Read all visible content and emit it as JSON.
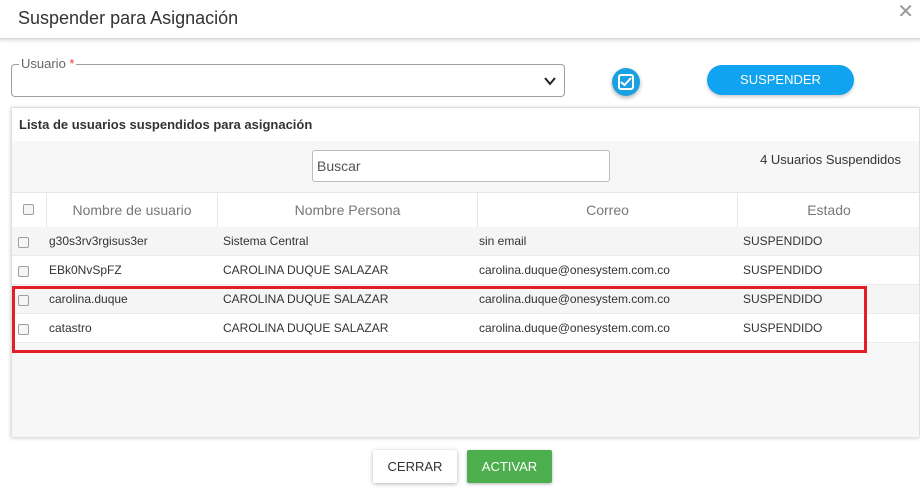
{
  "dialog": {
    "title": "Suspender para Asignación",
    "close_icon": "close-icon"
  },
  "form": {
    "usuario_label": "Usuario",
    "required_mark": "*",
    "usuario_value": "",
    "suspend_label": "SUSPENDER"
  },
  "list": {
    "title": "Lista de usuarios suspendidos para asignación",
    "search_placeholder": "Buscar",
    "count_text": "4 Usuarios Suspendidos",
    "columns": [
      "Nombre de usuario",
      "Nombre Persona",
      "Correo",
      "Estado"
    ],
    "rows": [
      {
        "username": "g30s3rv3rgisus3er",
        "person": "Sistema Central",
        "email": "sin email",
        "status": "SUSPENDIDO"
      },
      {
        "username": "EBk0NvSpFZ",
        "person": "CAROLINA DUQUE SALAZAR",
        "email": "carolina.duque@onesystem.com.co",
        "status": "SUSPENDIDO"
      },
      {
        "username": "carolina.duque",
        "person": "CAROLINA DUQUE SALAZAR",
        "email": "carolina.duque@onesystem.com.co",
        "status": "SUSPENDIDO"
      },
      {
        "username": "catastro",
        "person": "CAROLINA DUQUE SALAZAR",
        "email": "carolina.duque@onesystem.com.co",
        "status": "SUSPENDIDO"
      }
    ]
  },
  "footer": {
    "cerrar_label": "CERRAR",
    "activar_label": "ACTIVAR"
  },
  "colors": {
    "primary": "#0fa3f0",
    "success": "#4cae4c",
    "highlight": "#e01f26",
    "required": "#e53935"
  }
}
